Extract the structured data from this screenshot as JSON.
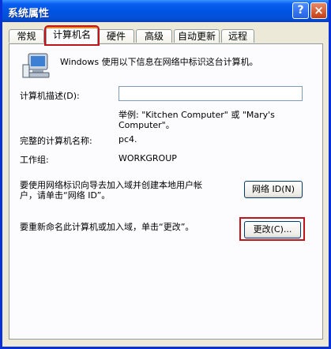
{
  "window": {
    "title": "系统属性",
    "help_label": "?",
    "close_label": "×"
  },
  "tabs": [
    {
      "label": "常规"
    },
    {
      "label": "计算机名",
      "active": true
    },
    {
      "label": "硬件"
    },
    {
      "label": "高级"
    },
    {
      "label": "自动更新"
    },
    {
      "label": "远程"
    }
  ],
  "panel": {
    "intro": "Windows 使用以下信息在网络中标识这台计算机。",
    "description_label": "计算机描述(D):",
    "description_value": "",
    "example_line1": "举例: \"Kitchen Computer\" 或 \"Mary's",
    "example_line2": "Computer\"。",
    "full_name_label": "完整的计算机名称:",
    "full_name_value": "pc4.",
    "workgroup_label": "工作组:",
    "workgroup_value": "WORKGROUP",
    "network_text_line1": "要使用网络标识向导去加入域并创建本地用户帐",
    "network_text_line2": "户，请单击“网络 ID”。",
    "network_id_button": "网络 ID(N)",
    "rename_text": "要重新命名此计算机或加入域，单击“更改”。",
    "change_button": "更改(C)..."
  },
  "colors": {
    "titlebar": "#0054e3",
    "highlight": "#c0141b",
    "tab_accent": "#e68b2c"
  }
}
